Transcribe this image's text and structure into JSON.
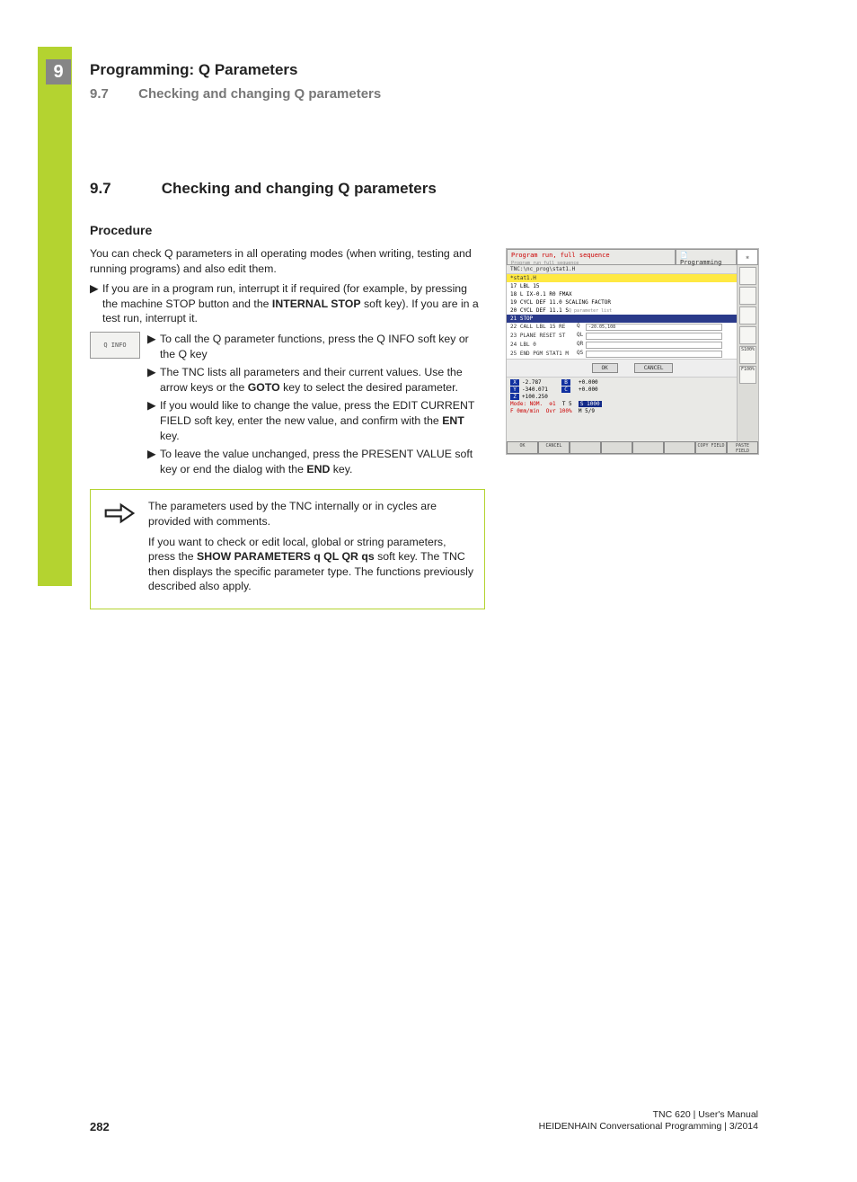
{
  "chapter_number": "9",
  "header": {
    "title": "Programming: Q Parameters",
    "section_num": "9.7",
    "section_title": "Checking and changing Q parameters"
  },
  "main": {
    "section_num": "9.7",
    "section_title": "Checking and changing Q parameters",
    "subsection": "Procedure",
    "intro": "You can check Q parameters in all operating modes (when writing, testing and running programs) and also edit them.",
    "bullet1_a": "If you are in a program run, interrupt it if required (for example, by pressing the machine STOP button and the ",
    "bullet1_b": "INTERNAL STOP",
    "bullet1_c": " soft key). If you are in a test run, interrupt it.",
    "softkey_label": "Q\nINFO",
    "sub1": "To call the Q parameter functions, press the Q INFO soft key or the Q key",
    "sub2_a": "The TNC lists all parameters and their current values. Use the arrow keys or the ",
    "sub2_b": "GOTO",
    "sub2_c": " key to select the desired parameter.",
    "sub3_a": "If you would like to change the value, press the EDIT CURRENT FIELD soft key, enter the new value, and confirm with the ",
    "sub3_b": "ENT",
    "sub3_c": " key.",
    "sub4_a": "To leave the value unchanged, press the PRESENT VALUE soft key or end the dialog with the ",
    "sub4_b": "END",
    "sub4_c": " key."
  },
  "note": {
    "p1": "The parameters used by the TNC internally or in cycles are provided with comments.",
    "p2_a": "If you want to check or edit local, global or string parameters, press the ",
    "p2_b": "SHOW PARAMETERS q QL QR qs",
    "p2_c": " soft key. The TNC then displays the specific parameter type. The functions previously described also apply."
  },
  "screenshot": {
    "mode_title": "Program run, full sequence",
    "mode_sub": "Program run full sequence",
    "right_title": "Programming",
    "path": "TNC:\\nc_prog\\stat1.H",
    "yellow": "*stat1.H",
    "lines": [
      "17 LBL 15",
      "18 L IX-0.1 R0 FMAX",
      "19 CYCL DEF 11.0 SCALING FACTOR",
      "20 CYCL DEF 11.1 S"
    ],
    "popup_title": "Q parameter list",
    "bluebar": "21 STOP",
    "inputs": [
      {
        "lbl": "22 CALL LBL 15 RE",
        "q": "Q",
        "val": "-20.05,108"
      },
      {
        "lbl": "23 PLANE RESET ST",
        "q": "QL",
        "val": ""
      },
      {
        "lbl": "24 LBL 0",
        "q": "QR",
        "val": ""
      },
      {
        "lbl": "25 END PGM STAT1 M",
        "q": "QS",
        "val": ""
      }
    ],
    "ok": "OK",
    "cancel": "CANCEL",
    "coords": [
      {
        "axis": "X",
        "v1": "-2.787",
        "a2": "B",
        "v2": "+0.000"
      },
      {
        "axis": "Y",
        "v1": "-340.071",
        "a2": "C",
        "v2": "+0.000"
      },
      {
        "axis": "Z",
        "v1": "+100.250",
        "a2": "",
        "v2": ""
      }
    ],
    "status_mode": "Mode: NOM.",
    "status_t": "T 5",
    "status_s": "S 1000",
    "status_f": "F 0mm/min",
    "status_ovr": "Ovr 100%",
    "status_m": "M 5/9",
    "softkeys": [
      "OK",
      "CANCEL",
      "",
      "",
      "",
      "",
      "COPY FIELD",
      "PASTE FIELD"
    ],
    "side_labels": [
      "",
      "",
      "",
      "",
      "S100%",
      "F100%"
    ]
  },
  "footer": {
    "page": "282",
    "line1": "TNC 620 | User's Manual",
    "line2": "HEIDENHAIN Conversational Programming | 3/2014"
  }
}
